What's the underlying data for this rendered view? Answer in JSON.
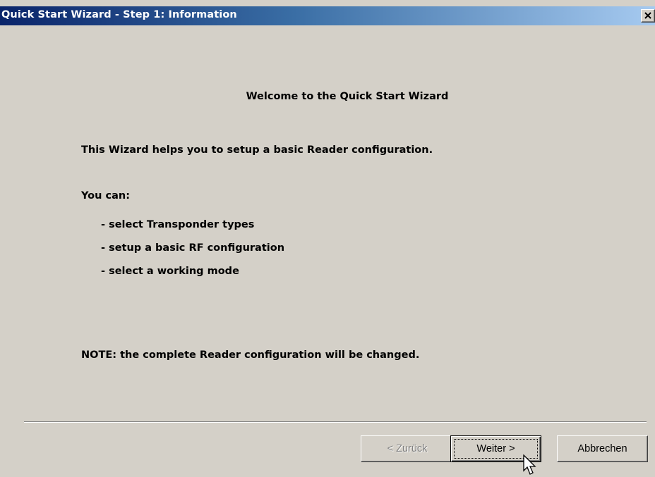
{
  "window": {
    "title": "Quick Start Wizard - Step 1: Information"
  },
  "content": {
    "heading": "Welcome to the Quick Start Wizard",
    "intro": "This Wizard helps you to setup a basic Reader configuration.",
    "you_can": "You can:",
    "items": [
      "- select Transponder types",
      "- setup a basic RF configuration",
      "- select a working mode"
    ],
    "note": "NOTE: the complete Reader configuration will be changed."
  },
  "buttons": {
    "back": "< Zurück",
    "next": "Weiter >",
    "cancel": "Abbrechen"
  },
  "icons": {
    "close": "close-icon",
    "cursor": "mouse-pointer-icon"
  },
  "colors": {
    "titlebar_start": "#0a246a",
    "titlebar_end": "#a6caf0",
    "window_bg": "#d4d0c8",
    "disabled_text": "#808080"
  }
}
